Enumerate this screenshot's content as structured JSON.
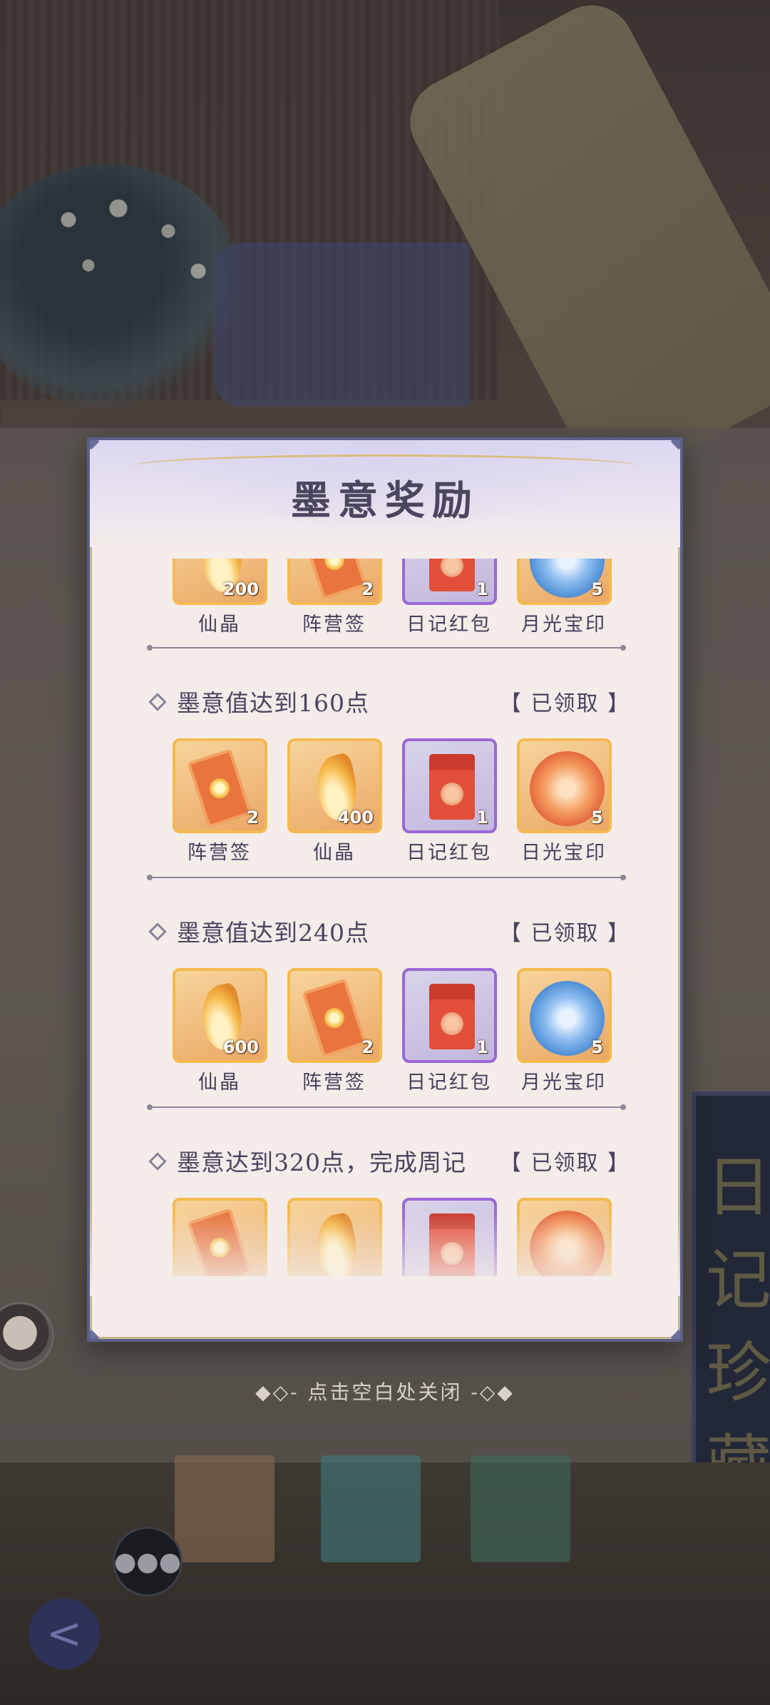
{
  "modal": {
    "title": "墨意奖励",
    "close_hint": "◆◇- 点击空白处关闭 -◇◆"
  },
  "top_partial_row": {
    "items": [
      {
        "name": "仙晶",
        "qty": "200",
        "icon": "crystal-icon",
        "rarity": "gold"
      },
      {
        "name": "阵营签",
        "qty": "2",
        "icon": "faction-tag-icon",
        "rarity": "gold"
      },
      {
        "name": "日记红包",
        "qty": "1",
        "icon": "red-envelope-icon",
        "rarity": "purple"
      },
      {
        "name": "月光宝印",
        "qty": "5",
        "icon": "moonlight-seal-icon",
        "rarity": "gold"
      }
    ]
  },
  "milestones": [
    {
      "title": "墨意值达到160点",
      "status": "【 已领取 】",
      "items": [
        {
          "name": "阵营签",
          "qty": "2",
          "icon": "faction-tag-icon",
          "rarity": "gold"
        },
        {
          "name": "仙晶",
          "qty": "400",
          "icon": "crystal-icon",
          "rarity": "gold"
        },
        {
          "name": "日记红包",
          "qty": "1",
          "icon": "red-envelope-icon",
          "rarity": "purple"
        },
        {
          "name": "日光宝印",
          "qty": "5",
          "icon": "sunlight-seal-icon",
          "rarity": "gold"
        }
      ]
    },
    {
      "title": "墨意值达到240点",
      "status": "【 已领取 】",
      "items": [
        {
          "name": "仙晶",
          "qty": "600",
          "icon": "crystal-icon",
          "rarity": "gold"
        },
        {
          "name": "阵营签",
          "qty": "2",
          "icon": "faction-tag-icon",
          "rarity": "gold"
        },
        {
          "name": "日记红包",
          "qty": "1",
          "icon": "red-envelope-icon",
          "rarity": "purple"
        },
        {
          "name": "月光宝印",
          "qty": "5",
          "icon": "moonlight-seal-icon",
          "rarity": "gold"
        }
      ]
    },
    {
      "title": "墨意达到320点，完成周记",
      "status": "【 已领取 】",
      "items": [
        {
          "icon": "faction-tag-icon",
          "rarity": "gold"
        },
        {
          "icon": "crystal-icon",
          "rarity": "gold"
        },
        {
          "icon": "red-envelope-icon",
          "rarity": "purple"
        },
        {
          "icon": "sunlight-seal-icon",
          "rarity": "gold"
        }
      ]
    }
  ],
  "colors": {
    "panel_bg": "#f3ece9",
    "panel_border": "#5b5f88",
    "gold_frame": "#f5b94e",
    "purple_frame": "#9a67d6",
    "title_text": "#4b4560"
  }
}
